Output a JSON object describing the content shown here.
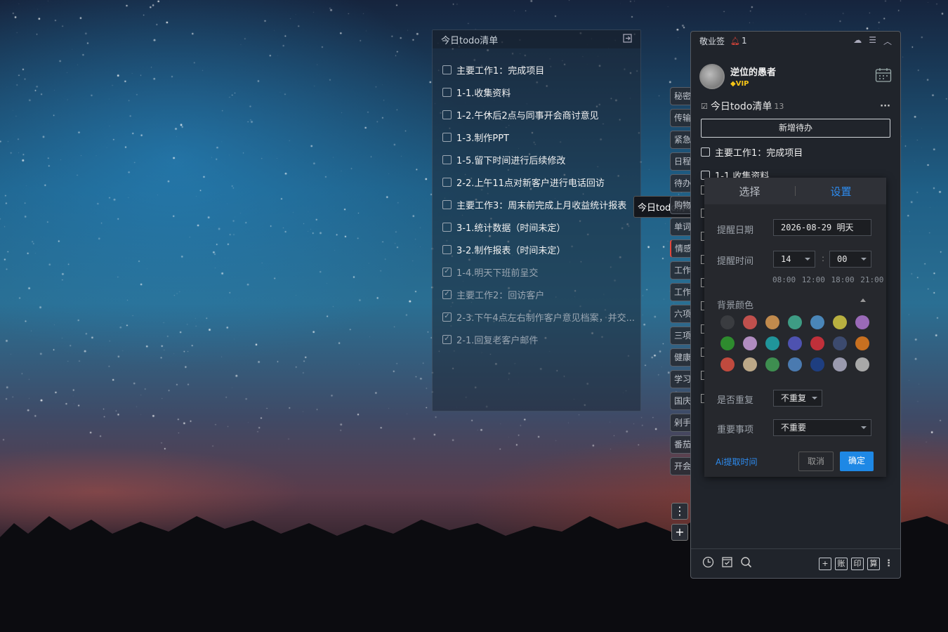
{
  "sticky": {
    "title": "今日todo清单",
    "items": [
      {
        "text": "主要工作1：完成项目",
        "done": false
      },
      {
        "text": "1-1.收集资料",
        "done": false
      },
      {
        "text": "1-2.午休后2点与同事开会商讨意见",
        "done": false
      },
      {
        "text": "1-3.制作PPT",
        "done": false
      },
      {
        "text": "1-5.留下时间进行后续修改",
        "done": false
      },
      {
        "text": "2-2.上午11点对新客户进行电话回访",
        "done": false
      },
      {
        "text": "主要工作3：周末前完成上月收益统计报表",
        "done": false
      },
      {
        "text": "3-1.统计数据（时间未定）",
        "done": false
      },
      {
        "text": "3-2.制作报表（时间未定）",
        "done": false
      },
      {
        "text": "1-4.明天下班前呈交",
        "done": true
      },
      {
        "text": "主要工作2：回访客户",
        "done": true
      },
      {
        "text": "2-3.下午4点左右制作客户意见档案，并交...",
        "done": true
      },
      {
        "text": "2-1.回复老客户邮件",
        "done": true
      }
    ]
  },
  "tooltip": "今日todo清单",
  "tabs": [
    "秘密",
    "传输",
    "紧急",
    "日程",
    "待办",
    "购物",
    "单词",
    "情感",
    "工作",
    "工作",
    "六项",
    "三项",
    "健康",
    "学习",
    "国庆",
    "剁手",
    "番茄",
    "开会"
  ],
  "tab_more": "⋮",
  "tab_add": "+",
  "panel": {
    "app": "敬业签",
    "notif": "1",
    "user": "逆位的愚者",
    "vip": "VIP",
    "list_title": "今日todo清单",
    "list_count": "13",
    "add_label": "新增待办",
    "items": [
      "主要工作1：完成项目",
      "1-1.收集资料"
    ],
    "footer": [
      "+",
      "账",
      "印",
      "算"
    ]
  },
  "popup": {
    "tab_select": "选择",
    "tab_settings": "设置",
    "date_label": "提醒日期",
    "date_value": "2026-08-29 明天",
    "time_label": "提醒时间",
    "hour": "14",
    "colon": ":",
    "minute": "00",
    "quick_times": "08:00 12:00 18:00 21:00",
    "bg_label": "背景颜色",
    "colors": [
      "#3a3c40",
      "#c0504d",
      "#c08a4d",
      "#3e9c84",
      "#4a86b8",
      "#b8b040",
      "#9a6ab8",
      "#2e8b2e",
      "#b08cc0",
      "#20959b",
      "#4e52b0",
      "#c0303a",
      "#3c4a6e",
      "#c87020",
      "#c04a3e",
      "#bca888",
      "#3e8e50",
      "#4a7ab0",
      "#1e3e80",
      "#9a9aae",
      "#a8a8a8"
    ],
    "repeat_label": "是否重复",
    "repeat_value": "不重复",
    "important_label": "重要事项",
    "important_value": "不重要",
    "ai_label": "Ai提取时间",
    "cancel": "取消",
    "ok": "确定"
  },
  "colors": {
    "accent": "#1e88e5",
    "link": "#2d8cf0"
  }
}
